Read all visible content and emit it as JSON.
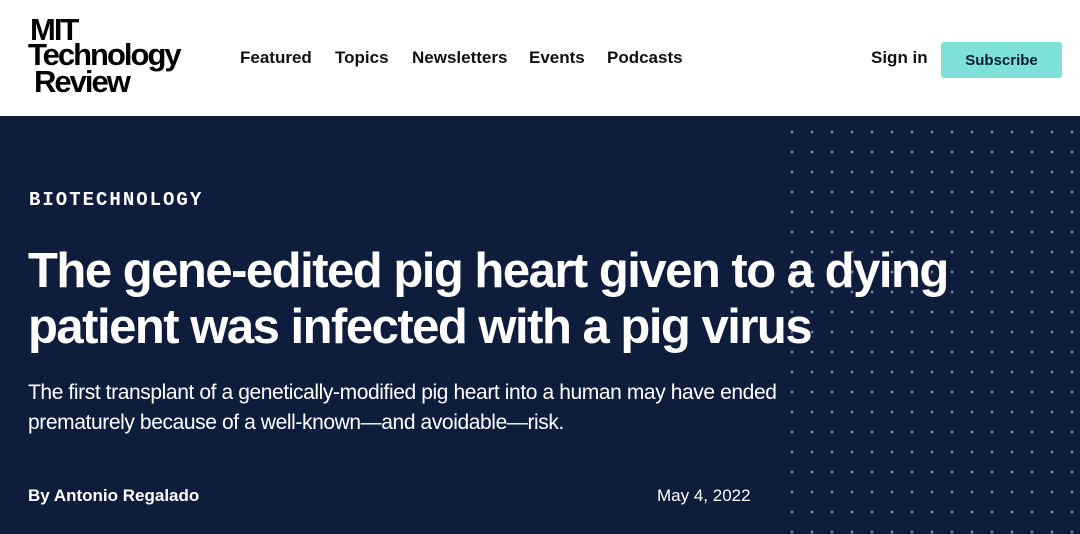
{
  "header": {
    "logo": {
      "line1": "MIT",
      "line2": "Technology",
      "line3": "Review"
    },
    "nav": [
      "Featured",
      "Topics",
      "Newsletters",
      "Events",
      "Podcasts"
    ],
    "sign_in": "Sign in",
    "subscribe": "Subscribe",
    "subscribe_color": "#7de1d7"
  },
  "article": {
    "category": "BIOTECHNOLOGY",
    "headline": "The gene-edited pig heart given to a dying patient was infected with a pig virus",
    "dek": "The first transplant of a genetically-modified pig heart into a human may have ended prematurely because of a well-known—and avoidable—risk.",
    "byline": "By Antonio Regalado",
    "date": "May 4, 2022",
    "background_color": "#0f1d3d"
  }
}
